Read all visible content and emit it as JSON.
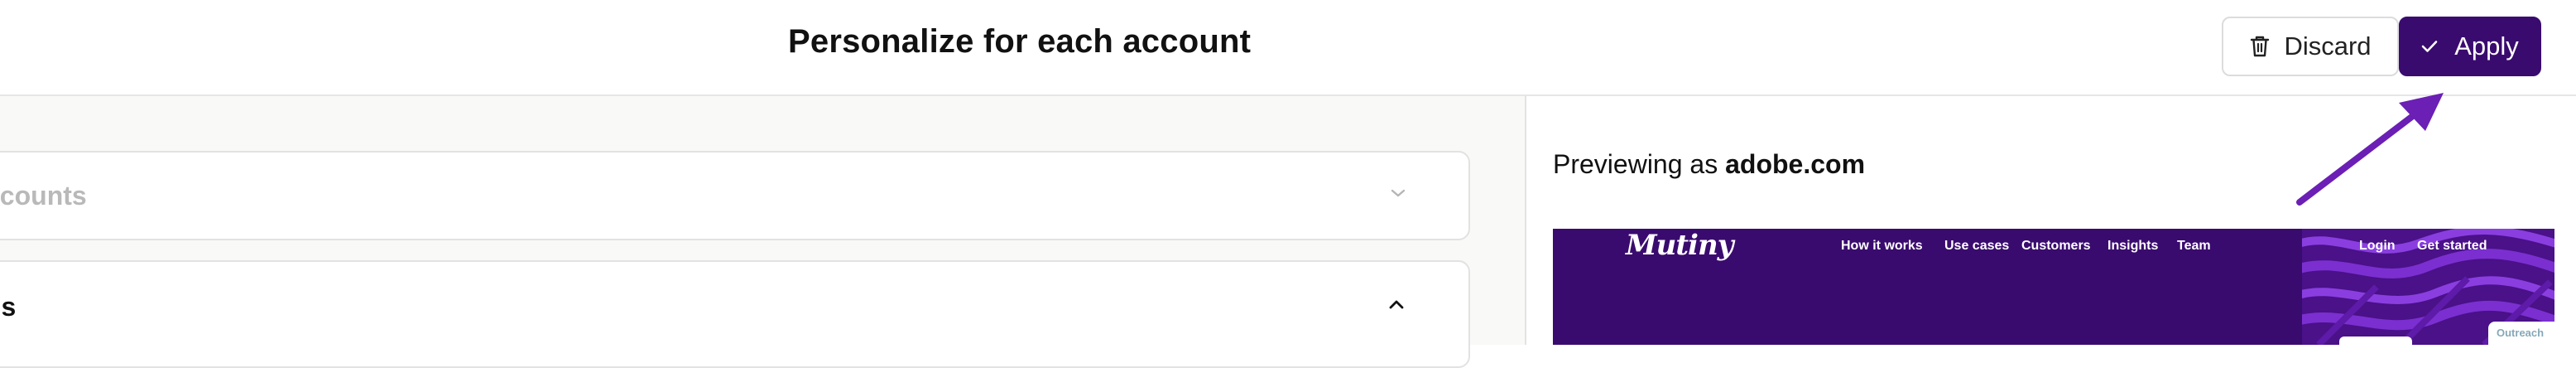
{
  "header": {
    "title": "Personalize for each account",
    "discard_label": "Discard",
    "apply_label": "Apply"
  },
  "sections": [
    {
      "label": "ccounts",
      "state": "collapsed",
      "chevron": "chevron-down-icon"
    },
    {
      "label": "ns",
      "state": "expanded",
      "chevron": "chevron-up-icon"
    }
  ],
  "preview": {
    "prefix": "Previewing as",
    "account": "adobe.com",
    "site": {
      "logo": "Mutiny",
      "nav": [
        "How it works",
        "Use cases",
        "Customers",
        "Insights",
        "Team"
      ],
      "login": "Login",
      "cta": "Get started",
      "badge": "Outreach"
    }
  },
  "colors": {
    "brand_purple": "#3a0b6e",
    "annotation_arrow": "#6b1fb5",
    "pattern_purple": "#7b2fd0"
  }
}
